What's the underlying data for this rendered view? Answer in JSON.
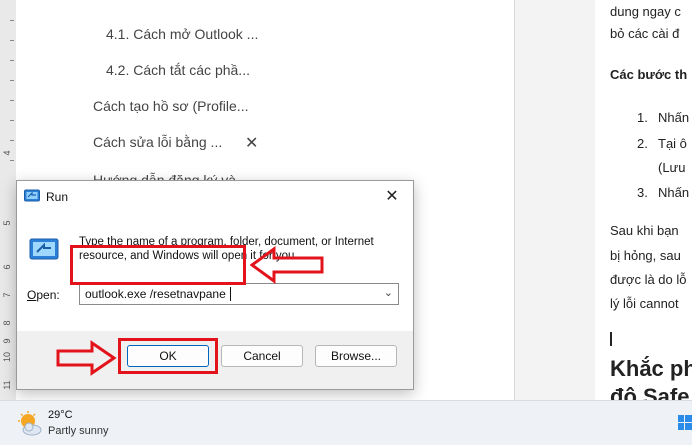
{
  "document": {
    "toc_items": [
      "4.1. Cách mở Outlook ...",
      "4.2. Cách tắt các phầ...",
      "Cách tạo hồ sơ (Profile...",
      "Cách sửa lỗi bằng ...",
      "Hướng dẫn đăng ký và ..."
    ],
    "toc_close_glyph": "✕",
    "right_column": {
      "lines": [
        "dung ngay c",
        "bỏ các cài đ"
      ],
      "bold_line": "Các bước th",
      "numbered": [
        {
          "num": "1.",
          "text": "Nhấn"
        },
        {
          "num": "2.",
          "text": "Tại ô"
        },
        {
          "num": "",
          "text": "(Lưu"
        },
        {
          "num": "3.",
          "text": "Nhấn"
        }
      ],
      "paragraph": [
        "Sau khi bạn",
        "bị hỏng, sau",
        "được là do lỗ",
        "lý lỗi cannot"
      ],
      "heading": [
        "Khắc ph",
        "độ Safe"
      ]
    }
  },
  "ruler": {
    "numbers": [
      "4",
      "5",
      "6",
      "7",
      "8",
      "9",
      "10",
      "11"
    ]
  },
  "run_dialog": {
    "title": "Run",
    "close_glyph": "✕",
    "description": "Type the name of a program, folder, document, or Internet resource, and Windows will open it for you.",
    "open_label_prefix": "O",
    "open_label_rest": "pen:",
    "open_value": "outlook.exe /resetnavpane",
    "dropdown_glyph": "⌄",
    "buttons": {
      "ok": "OK",
      "cancel": "Cancel",
      "browse": "Browse..."
    }
  },
  "taskbar": {
    "temperature": "29°C",
    "condition": "Partly sunny"
  },
  "colors": {
    "annotation_red": "#e3131b",
    "ok_border": "#0067c0"
  }
}
